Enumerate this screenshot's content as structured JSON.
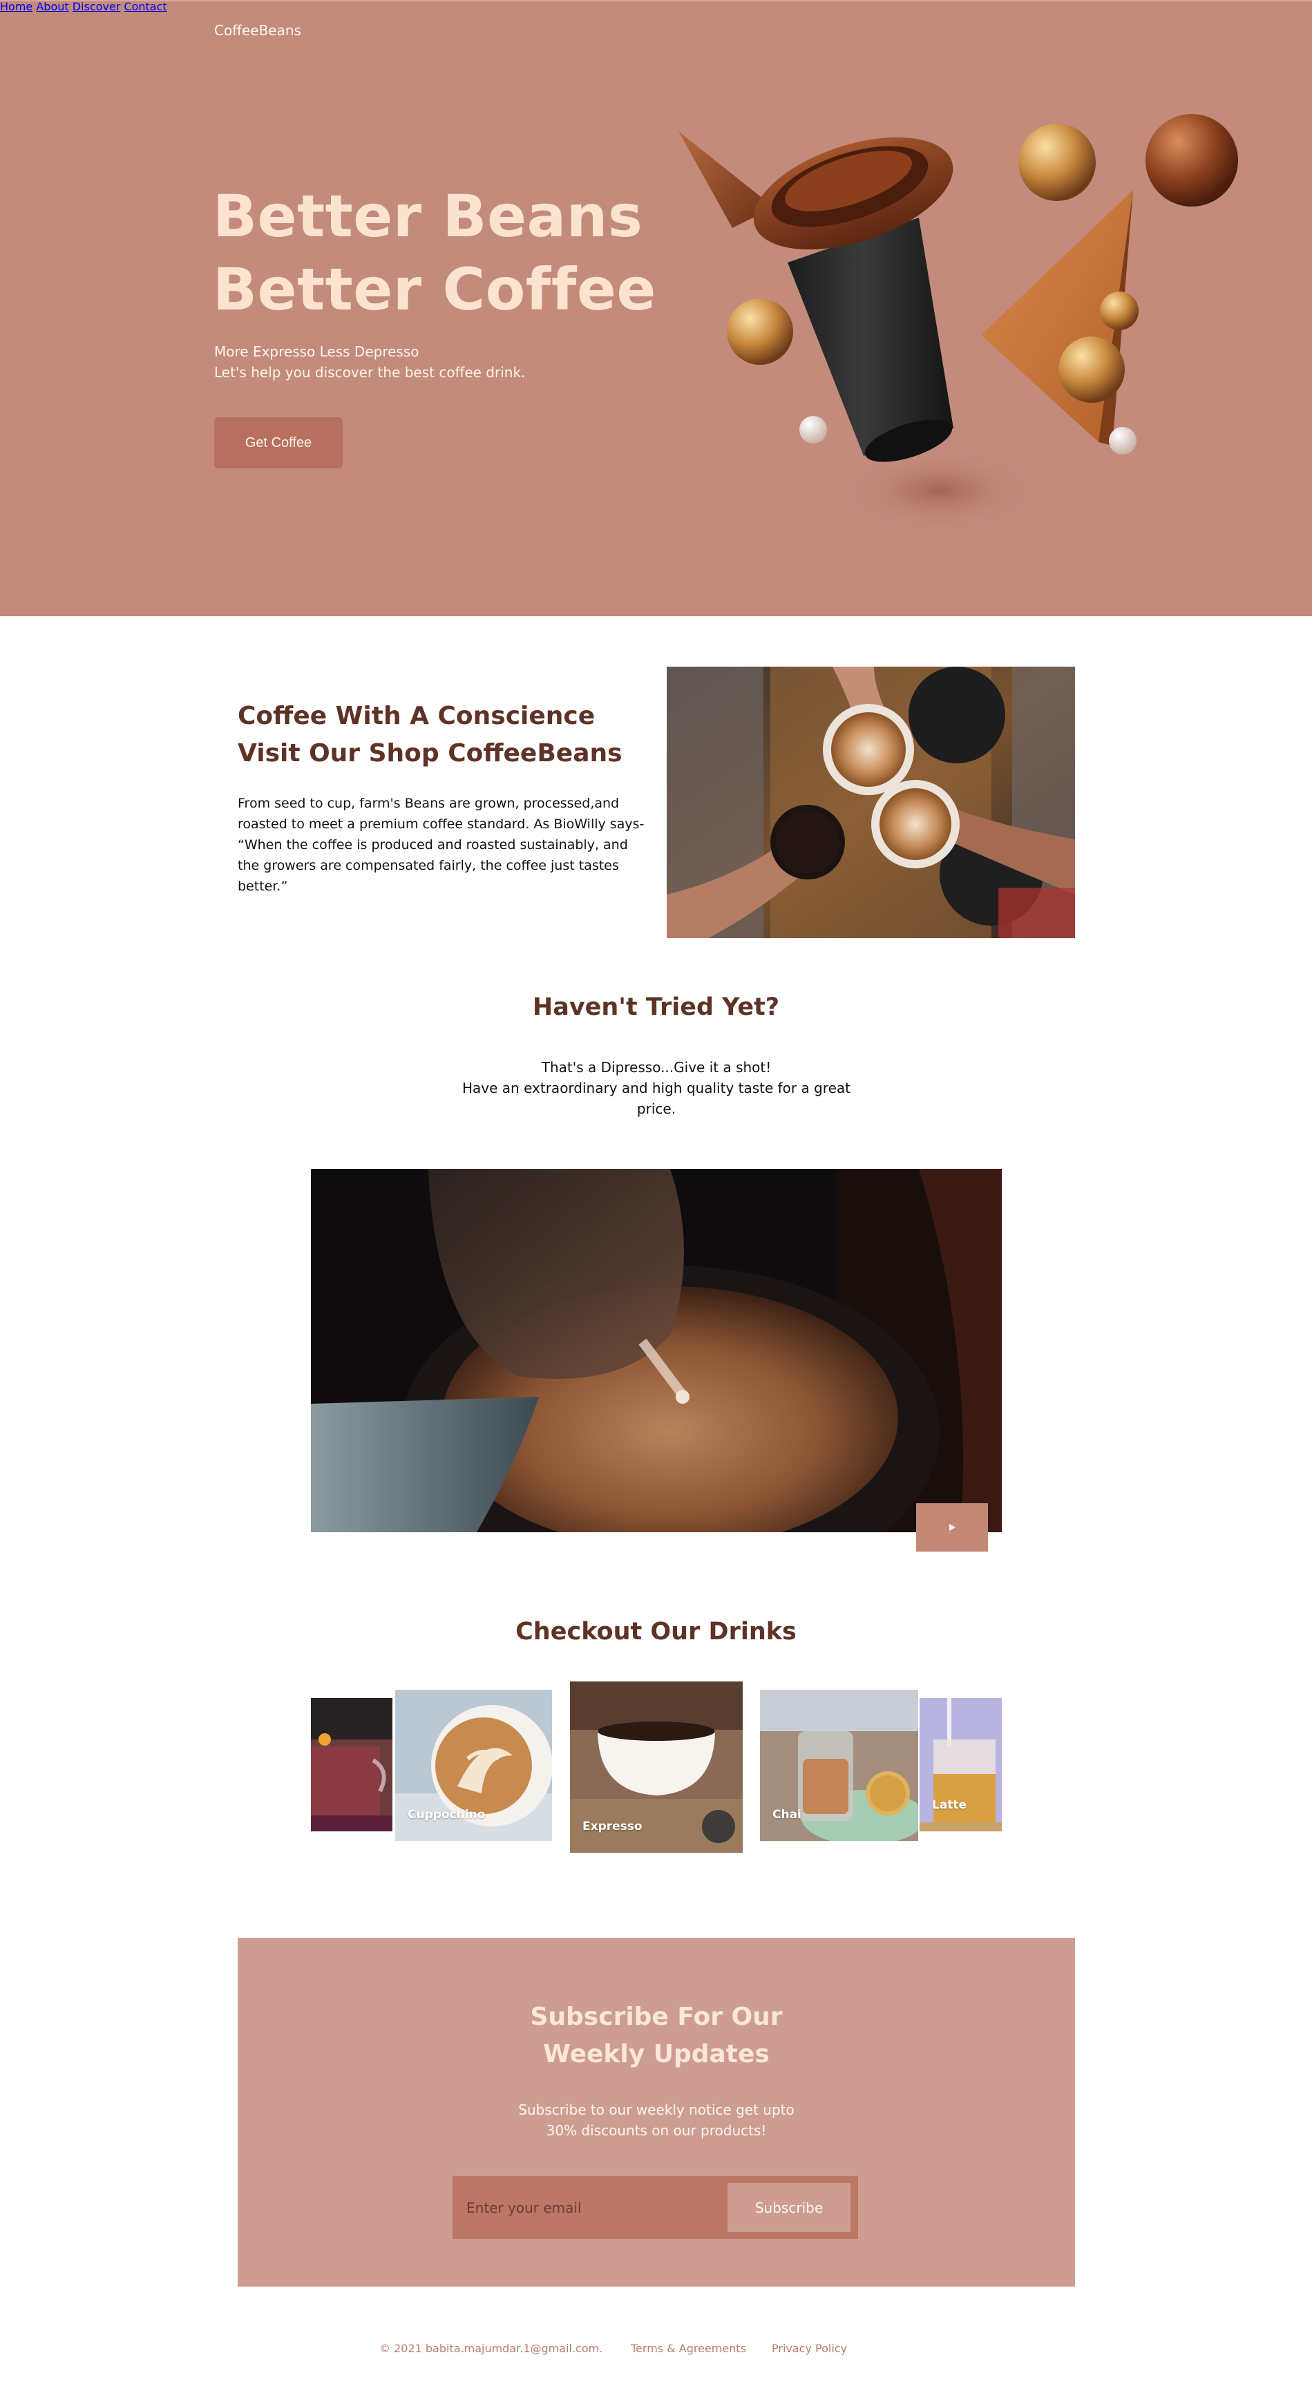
{
  "brand": "CoffeeBeans",
  "nav": {
    "items": [
      "Home",
      "About",
      "Discover",
      "Contact"
    ]
  },
  "hero": {
    "title_line1": "Better Beans",
    "title_line2": "Better Coffee",
    "sub_line1": "More Expresso Less Depresso",
    "sub_line2": "Let's help you discover the best coffee drink.",
    "button": "Get Coffee"
  },
  "about": {
    "title_line1": "Coffee With A Conscience",
    "title_line2": "Visit Our Shop CoffeeBeans",
    "text": "From seed to cup, farm's Beans are grown, processed,and roasted to meet a premium coffee standard. As BioWilly says- “When the coffee is produced and roasted sustainably, and the growers are compensated fairly, the coffee just tastes better.”"
  },
  "tried": {
    "title": "Haven't Tried Yet?",
    "line1": "That's a Dipresso...Give it a shot!",
    "line2": "Have an extraordinary and high quality taste for a great price.",
    "play_icon": "play-icon"
  },
  "drinks": {
    "title": "Checkout Our Drinks",
    "items": [
      {
        "label": ""
      },
      {
        "label": "Cuppochino"
      },
      {
        "label": "Expresso"
      },
      {
        "label": "Chai"
      },
      {
        "label": "Latte"
      }
    ]
  },
  "subscribe": {
    "title_line1": "Subscribe For Our",
    "title_line2": "Weekly Updates",
    "text_line1": "Subscribe to our weekly notice get upto",
    "text_line2": "30% discounts on our products!",
    "placeholder": "Enter your email",
    "button": "Subscribe"
  },
  "footer": {
    "copyright": "© 2021 babita.majumdar.1@gmail.com.",
    "terms": "Terms & Agreements",
    "privacy": "Privacy Policy"
  },
  "colors": {
    "hero_bg": "#c38b7c",
    "heading_brown": "#5e3326",
    "subscribe_bg": "#cd9d92",
    "button_dark": "#b86f5f"
  }
}
